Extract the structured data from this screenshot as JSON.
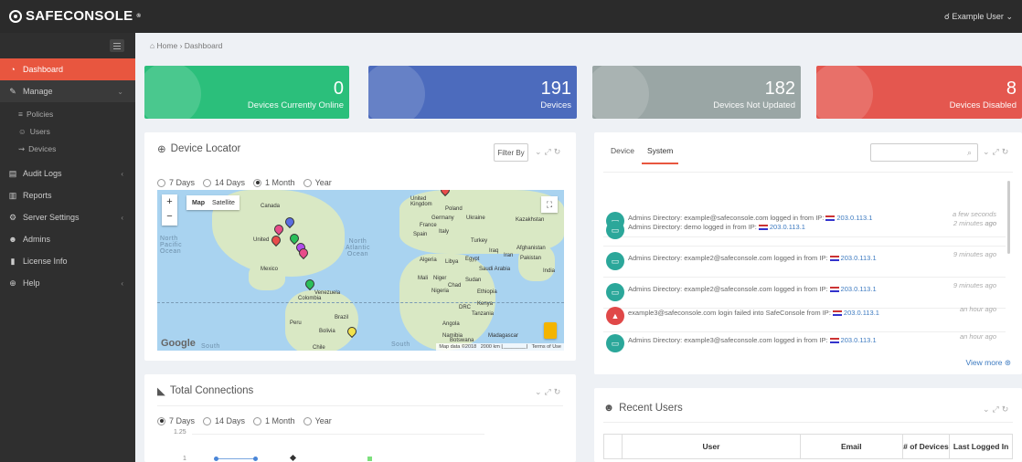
{
  "app": {
    "logo": "SAFECONSOLE",
    "user_menu": "Example User"
  },
  "sidebar": {
    "items": [
      {
        "label": "Dashboard",
        "icon": "dashboard-icon"
      },
      {
        "label": "Manage",
        "icon": "wrench-icon"
      },
      {
        "label": "Audit Logs",
        "icon": "book-icon"
      },
      {
        "label": "Reports",
        "icon": "bar-chart-icon"
      },
      {
        "label": "Server Settings",
        "icon": "cogs-icon"
      },
      {
        "label": "Admins",
        "icon": "users-icon"
      },
      {
        "label": "License Info",
        "icon": "file-icon"
      },
      {
        "label": "Help",
        "icon": "life-ring-icon"
      }
    ],
    "sub_items": [
      {
        "label": "Policies",
        "icon": "sliders-icon"
      },
      {
        "label": "Users",
        "icon": "user-icon"
      },
      {
        "label": "Devices",
        "icon": "usb-icon"
      }
    ]
  },
  "breadcrumb": {
    "home": "Home",
    "sep": "›",
    "current": "Dashboard"
  },
  "stats": [
    {
      "value": "0",
      "label": "Devices Currently Online",
      "color": "#2bbf7b"
    },
    {
      "value": "191",
      "label": "Devices",
      "color": "#4c6bbd"
    },
    {
      "value": "182",
      "label": "Devices Not Updated",
      "color": "#9aa6a5"
    },
    {
      "value": "8",
      "label": "Devices Disabled",
      "color": "#e4574f"
    }
  ],
  "device_locator": {
    "title": "Device Locator",
    "filter_label": "Filter By",
    "ranges": [
      "7 Days",
      "14 Days",
      "1 Month",
      "Year"
    ],
    "selected_range": "1 Month",
    "map": {
      "map_btn": "Map",
      "satellite_btn": "Satellite",
      "zoom_in": "+",
      "zoom_out": "−",
      "google": "Google",
      "attribution": "Map data ©2018   2000 km ⌊________⌋   Terms of Use",
      "labels": {
        "north_pacific": "North\nPacific\nOcean",
        "north_atlantic": "North\nAtlantic\nOcean",
        "canada": "Canada",
        "united": "United",
        "mexico": "Mexico",
        "colombia": "Colombia",
        "venezuela": "Venezuela",
        "peru": "Peru",
        "brazil": "Brazil",
        "bolivia": "Bolivia",
        "chile": "Chile",
        "uk": "United\nKingdom",
        "poland": "Poland",
        "germany": "Germany",
        "ukraine": "Ukraine",
        "france": "France",
        "spain": "Spain",
        "italy": "Italy",
        "kazakhstan": "Kazakhstan",
        "turkey": "Turkey",
        "iraq": "Iraq",
        "iran": "Iran",
        "afghanistan": "Afghanistan",
        "pakistan": "Pakistan",
        "algeria": "Algeria",
        "libya": "Libya",
        "egypt": "Egypt",
        "saudi": "Saudi Arabia",
        "india": "India",
        "mali": "Mali",
        "niger": "Niger",
        "chad": "Chad",
        "sudan": "Sudan",
        "nigeria": "Nigeria",
        "ethiopia": "Ethiopia",
        "drc": "DRC",
        "kenya": "Kenya",
        "tanzania": "Tanzania",
        "angola": "Angola",
        "namibia": "Namibia",
        "botswana": "Botswana",
        "madagascar": "Madagascar",
        "south": "South"
      }
    }
  },
  "activity": {
    "tabs": [
      "Device",
      "System"
    ],
    "active_tab": "System",
    "search_placeholder": "",
    "logs": [
      {
        "text": "Admins Directory: example@safeconsole.com logged in from IP:",
        "ip": "203.0.113.1",
        "time": "a few seconds ago",
        "type": "device"
      },
      {
        "text": "Admins Directory: demo logged in from IP:",
        "ip": "203.0.113.1",
        "time": "2 minutes ago",
        "type": "device"
      },
      {
        "text": "Admins Directory: example2@safeconsole.com logged in from IP:",
        "ip": "203.0.113.1",
        "time": "9 minutes ago",
        "type": "device"
      },
      {
        "text": "Admins Directory: example2@safeconsole.com logged in from IP:",
        "ip": "203.0.113.1",
        "time": "9 minutes ago",
        "type": "device"
      },
      {
        "text": "example3@safeconsole.com login failed into SafeConsole from IP:",
        "ip": "203.0.113.1",
        "time": "an hour ago",
        "type": "alert"
      },
      {
        "text": "Admins Directory: example3@safeconsole.com logged in from IP:",
        "ip": "203.0.113.1",
        "time": "an hour ago",
        "type": "device"
      }
    ],
    "view_more": "View more"
  },
  "total_connections": {
    "title": "Total Connections",
    "ranges": [
      "7 Days",
      "14 Days",
      "1 Month",
      "Year"
    ],
    "selected_range": "7 Days",
    "y_ticks": [
      "1.25",
      "1"
    ]
  },
  "recent_users": {
    "title": "Recent Users",
    "columns": [
      "User",
      "Email",
      "# of Devices",
      "Last Logged In"
    ]
  }
}
